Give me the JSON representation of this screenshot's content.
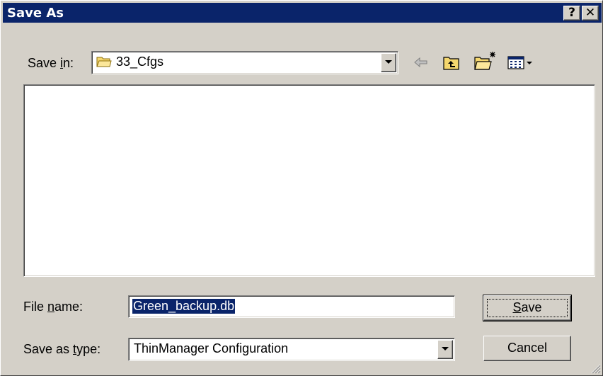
{
  "window": {
    "title": "Save As",
    "help_glyph": "?",
    "close_glyph": "✕"
  },
  "save_in": {
    "label_pre": "Save ",
    "label_accel": "i",
    "label_post": "n:",
    "value": "33_Cfgs",
    "icon": "folder-icon"
  },
  "toolbar": {
    "back": "back-arrow-icon",
    "up": "up-one-level-icon",
    "new_folder": "new-folder-icon",
    "view_menu": "view-menu-icon"
  },
  "file_name": {
    "label_pre": "File ",
    "label_accel": "n",
    "label_post": "ame:",
    "value": "Green_backup.db"
  },
  "save_type": {
    "label_pre": "Save as ",
    "label_accel": "t",
    "label_post": "ype:",
    "value": "ThinManager Configuration"
  },
  "buttons": {
    "save_accel": "S",
    "save_rest": "ave",
    "cancel": "Cancel"
  },
  "colors": {
    "titlebar": "#0a246a",
    "face": "#d4d0c8",
    "selection": "#0a246a"
  }
}
